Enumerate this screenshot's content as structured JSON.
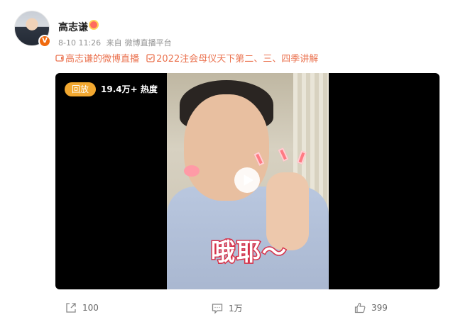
{
  "post": {
    "author": "高志谦",
    "time": "8-10 11:26",
    "source_prefix": "来自",
    "source": "微博直播平台",
    "verify_mark": "V"
  },
  "topics": [
    {
      "icon": "live-icon",
      "text": "高志谦的微博直播"
    },
    {
      "icon": "check-icon",
      "text": "2022注会母仪天下第二、三、四季讲解"
    }
  ],
  "video": {
    "status_badge": "回放",
    "heat": "19.4万+ 热度",
    "caption": "哦耶～"
  },
  "actions": {
    "share_count": "100",
    "comment_count": "1万",
    "like_count": "399"
  },
  "colors": {
    "accent": "#eb7350",
    "badge": "#f2a830",
    "verify": "#f06a0f"
  }
}
